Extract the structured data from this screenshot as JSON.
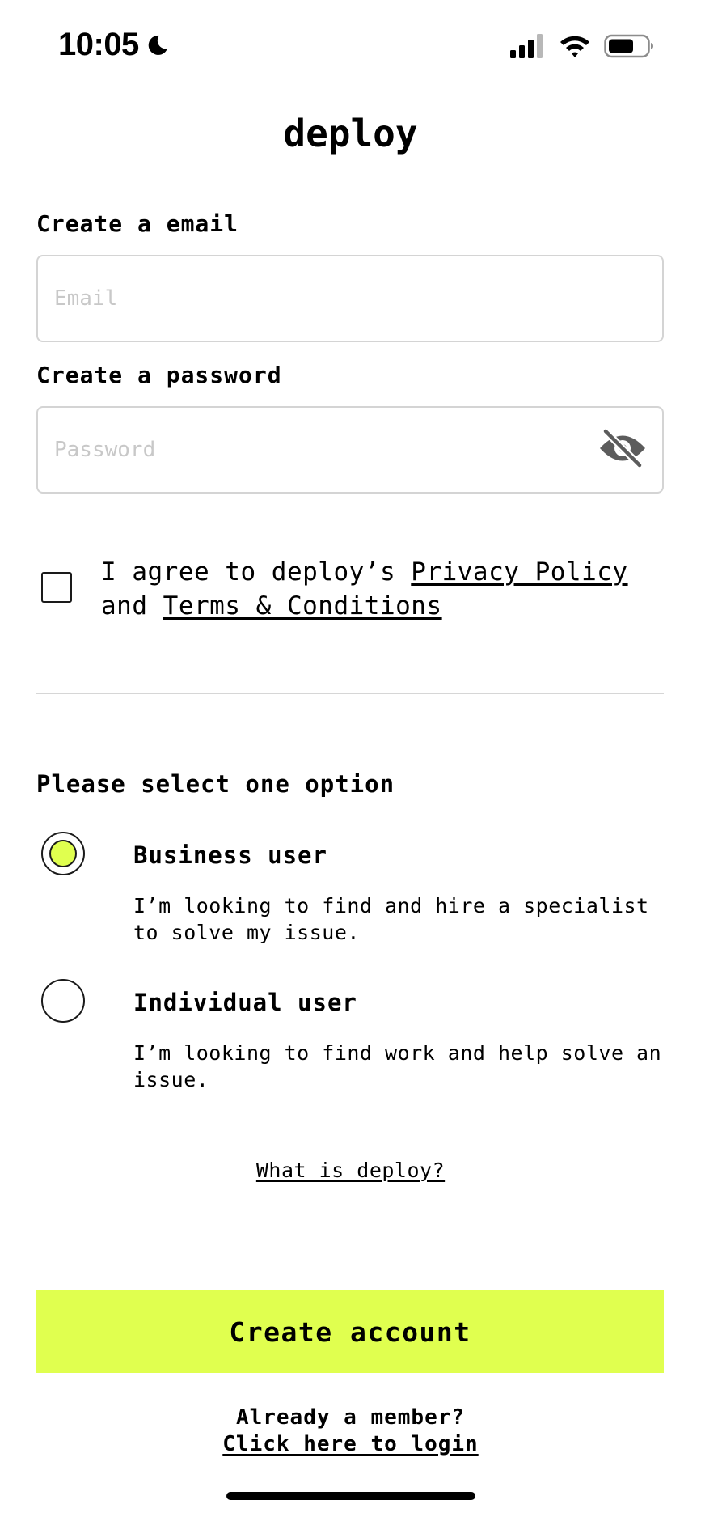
{
  "status_bar": {
    "time": "10:05",
    "moon_icon": "moon-icon",
    "signal_icon": "cellular-signal-icon",
    "wifi_icon": "wifi-icon",
    "battery_icon": "battery-icon"
  },
  "app_title": "deploy",
  "email": {
    "label": "Create a email",
    "placeholder": "Email",
    "value": ""
  },
  "password": {
    "label": "Create a password",
    "placeholder": "Password",
    "value": "",
    "toggle_icon": "eye-off-icon"
  },
  "agreement": {
    "checked": false,
    "prefix": "I agree to deploy’s ",
    "privacy_link": "Privacy Policy",
    "middle": "and ",
    "terms_link": "Terms & Conditions"
  },
  "user_type": {
    "title": "Please select one option",
    "selected": "business",
    "options": [
      {
        "id": "business",
        "label": "Business user",
        "description": "I’m looking to find and hire a specialist to solve my issue."
      },
      {
        "id": "individual",
        "label": "Individual user",
        "description": "I’m looking to find work and help solve an issue."
      }
    ]
  },
  "what_is_link": "What is deploy?",
  "create_button": "Create account",
  "footer": {
    "member_text": "Already a member?",
    "login_link": "Click here to login"
  },
  "colors": {
    "accent": "#e0ff4f",
    "text": "#000000",
    "input_border": "#d4d4d4",
    "placeholder": "#c8c8c8",
    "icon_gray": "#5c5c5c"
  }
}
